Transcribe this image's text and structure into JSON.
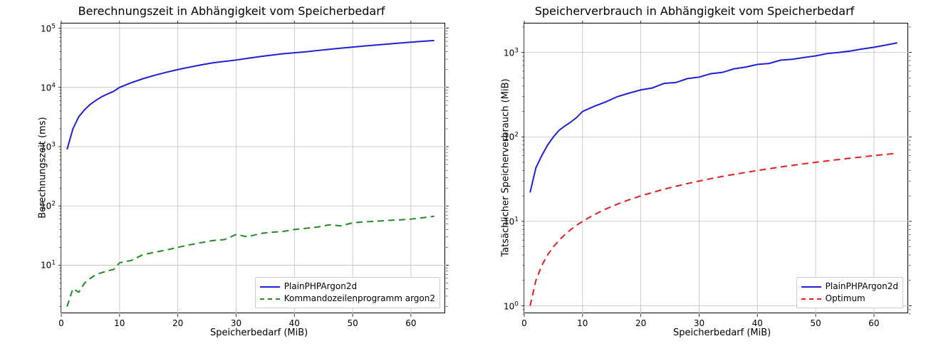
{
  "chart_data": [
    {
      "type": "line",
      "title": "Berechnungszeit in Abhängigkeit vom Speicherbedarf",
      "xlabel": "Speicherbedarf (MiB)",
      "ylabel": "Berechnungszeit (ms)",
      "xlim": [
        0,
        66
      ],
      "ylim": [
        1.5,
        120000
      ],
      "yscale": "log",
      "xticks": [
        0,
        10,
        20,
        30,
        40,
        50,
        60
      ],
      "yticks_exp": [
        1,
        2,
        3,
        4,
        5
      ],
      "legend_position": "lower right",
      "x": [
        1,
        2,
        3,
        4,
        5,
        6,
        7,
        8,
        9,
        10,
        12,
        14,
        16,
        18,
        20,
        22,
        24,
        26,
        28,
        30,
        32,
        34,
        36,
        38,
        40,
        42,
        44,
        46,
        48,
        50,
        52,
        54,
        56,
        58,
        60,
        62,
        64
      ],
      "series": [
        {
          "name": "PlainPHPArgon2d",
          "color": "#1f1fd8",
          "dash": "solid",
          "values": [
            900,
            2000,
            3200,
            4200,
            5200,
            6100,
            7000,
            7800,
            8600,
            10000,
            12000,
            14000,
            16000,
            18000,
            20000,
            22000,
            24000,
            26000,
            27500,
            29000,
            31000,
            33000,
            35000,
            37000,
            38500,
            40000,
            42000,
            44000,
            46000,
            48000,
            50000,
            52000,
            54000,
            56000,
            58000,
            60000,
            62000
          ]
        },
        {
          "name": "Kommandozeilenprogramm argon2",
          "color": "#228B22",
          "dash": "dashed",
          "values": [
            2,
            4,
            3.5,
            5,
            6,
            7,
            7.5,
            8,
            8.5,
            11,
            12,
            15,
            16.5,
            18,
            20,
            22,
            24,
            26,
            27,
            33,
            30,
            34,
            36,
            37,
            40,
            42,
            44,
            48,
            46,
            52,
            54,
            55,
            57,
            58,
            60,
            63,
            67
          ]
        }
      ]
    },
    {
      "type": "line",
      "title": "Speicherverbrauch in Abhängigkeit vom Speicherbedarf",
      "xlabel": "Speicherbedarf (MiB)",
      "ylabel": "Tatsächlicher Speicherverbrauch (MiB)",
      "xlim": [
        0,
        66
      ],
      "ylim": [
        0.8,
        2200
      ],
      "yscale": "log",
      "xticks": [
        0,
        10,
        20,
        30,
        40,
        50,
        60
      ],
      "yticks_exp": [
        0,
        1,
        2,
        3
      ],
      "legend_position": "lower right",
      "x": [
        1,
        2,
        3,
        4,
        5,
        6,
        7,
        8,
        9,
        10,
        12,
        14,
        16,
        18,
        20,
        22,
        24,
        26,
        28,
        30,
        32,
        34,
        36,
        38,
        40,
        42,
        44,
        46,
        48,
        50,
        52,
        54,
        56,
        58,
        60,
        62,
        64
      ],
      "series": [
        {
          "name": "PlainPHPArgon2d",
          "color": "#1f1fd8",
          "dash": "solid",
          "values": [
            22,
            43,
            60,
            80,
            100,
            120,
            135,
            150,
            170,
            200,
            230,
            260,
            300,
            330,
            360,
            380,
            430,
            440,
            490,
            510,
            560,
            580,
            640,
            670,
            720,
            740,
            810,
            830,
            870,
            910,
            970,
            1000,
            1040,
            1100,
            1150,
            1220,
            1300
          ]
        },
        {
          "name": "Optimum",
          "color": "#e02020",
          "dash": "dashed",
          "values": [
            1,
            2,
            3,
            4,
            5,
            6,
            7,
            8,
            9,
            10,
            12,
            14,
            16,
            18,
            20,
            22,
            24,
            26,
            28,
            30,
            32,
            34,
            36,
            38,
            40,
            42,
            44,
            46,
            48,
            50,
            52,
            54,
            56,
            58,
            60,
            62,
            64
          ]
        }
      ]
    }
  ]
}
